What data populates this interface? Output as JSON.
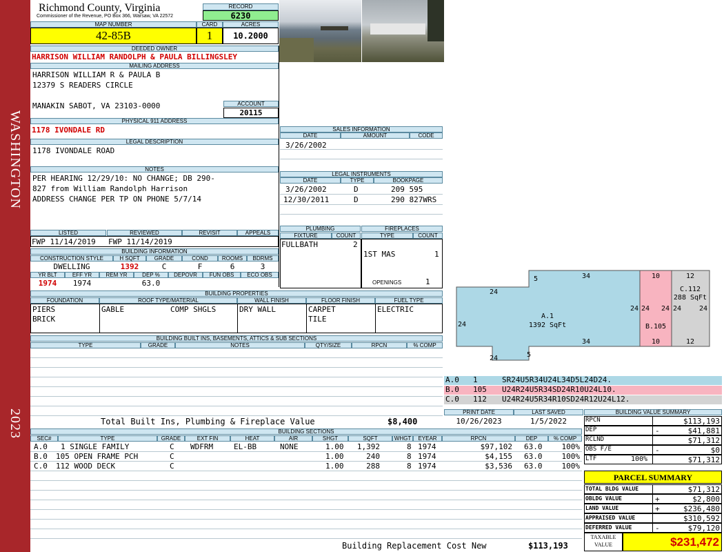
{
  "sidebar": {
    "district": "WASHINGTON",
    "year": "2023"
  },
  "header": {
    "county": "Richmond County, Virginia",
    "commissioner": "Commissioner of the Revenue, PO Box 366, Warsaw, VA 22572",
    "record_label": "RECORD",
    "record_value": "6230",
    "map_label": "MAP NUMBER",
    "map_value": "42-85B",
    "card_label": "CARD",
    "card_value": "1",
    "acres_label": "ACRES",
    "acres_value": "10.2000"
  },
  "owner": {
    "label": "DEEDED OWNER",
    "value": "HARRISON WILLIAM RANDOLPH & PAULA BILLINGSLEY"
  },
  "mailing": {
    "label": "MAILING ADDRESS",
    "line1": "HARRISON WILLIAM R & PAULA B",
    "line2": "12379 S READERS CIRCLE",
    "line3": "MANAKIN SABOT, VA 23103-0000"
  },
  "account": {
    "label": "ACCOUNT",
    "value": "20115"
  },
  "physical": {
    "label": "PHYSICAL 911 ADDRESS",
    "value": "1178 IVONDALE RD"
  },
  "legal": {
    "label": "LEGAL DESCRIPTION",
    "value": "1178 IVONDALE ROAD"
  },
  "notes": {
    "label": "NOTES",
    "line1": "PER HEARING 12/29/10: NO CHANGE; DB 290-",
    "line2": "827 from William Randolph Harrison",
    "line3": "ADDRESS CHANGE PER TP ON PHONE 5/7/14"
  },
  "sales": {
    "label": "SALES INFORMATION",
    "col_date": "DATE",
    "col_amount": "AMOUNT",
    "col_code": "CODE",
    "rows": [
      {
        "date": "3/26/2002",
        "amount": "",
        "code": ""
      }
    ]
  },
  "instruments": {
    "label": "LEGAL INSTRUMENTS",
    "col_date": "DATE",
    "col_type": "TYPE",
    "col_book": "BOOKPAGE",
    "rows": [
      {
        "date": "3/26/2002",
        "type": "D",
        "book": "209 595"
      },
      {
        "date": "12/30/2011",
        "type": "D",
        "book": "290 827WRS"
      }
    ]
  },
  "listed": {
    "listed_label": "LISTED",
    "listed_value": "FWP 11/14/2019",
    "reviewed_label": "REVIEWED",
    "reviewed_value": "FWP 11/14/2019",
    "revisit_label": "REVISIT",
    "revisit_value": "",
    "appeals_label": "APPEALS",
    "appeals_value": ""
  },
  "building_info": {
    "label": "BUILDING INFORMATION",
    "h_style": "CONSTRUCTION STYLE",
    "h_sqft": "H SQFT",
    "h_grade": "GRADE",
    "h_cond": "COND",
    "h_rooms": "ROOMS",
    "h_bdrms": "BDRMS",
    "style": "DWELLING",
    "sqft": "1392",
    "grade": "C",
    "cond": "F",
    "rooms": "6",
    "bdrms": "3",
    "h_yrblt": "YR BLT",
    "h_effyr": "EFF YR",
    "h_remyr": "REM YR",
    "h_dep": "DEP %",
    "h_depovr": "DEPOVR",
    "h_funobs": "FUN OBS",
    "h_ecoobs": "ECO OBS",
    "yrblt": "1974",
    "effyr": "1974",
    "remyr": "",
    "dep": "63.0",
    "depovr": "",
    "funobs": "",
    "ecoobs": ""
  },
  "plumbing": {
    "label": "PLUMBING",
    "col_fixture": "FIXTURE",
    "col_count": "COUNT",
    "fixture": "FULLBATH",
    "count": "2"
  },
  "fireplaces": {
    "label": "FIREPLACES",
    "col_type": "TYPE",
    "col_count": "COUNT",
    "type": "1ST MAS",
    "count": "1",
    "openings_label": "OPENINGS",
    "openings": "1"
  },
  "properties": {
    "label": "BUILDING PROPERTIES",
    "h_foundation": "FOUNDATION",
    "h_roof": "ROOF TYPE/MATERIAL",
    "h_wall": "WALL FINISH",
    "h_floor": "FLOOR FINISH",
    "h_fuel": "FUEL TYPE",
    "foundation1": "PIERS",
    "foundation2": "BRICK",
    "roof_type": "GABLE",
    "roof_mat": "COMP SHGLS",
    "wall": "DRY WALL",
    "floor1": "CARPET",
    "floor2": "TILE",
    "fuel": "ELECTRIC"
  },
  "builtins": {
    "label": "BUILDING BUILT INS, BASEMENTS, ATTICS & SUB SECTIONS",
    "h_type": "TYPE",
    "h_grade": "GRADE",
    "h_notes": "NOTES",
    "h_qty": "QTY/SIZE",
    "h_rpcn": "RPCN",
    "h_comp": "% COMP",
    "total_label": "Total Built Ins, Plumbing & Fireplace Value",
    "total_value": "$8,400"
  },
  "sections": {
    "label": "BUILDING SECTIONS",
    "headers": [
      "SEC#",
      "TYPE",
      "GRADE",
      "EXT FIN",
      "HEAT",
      "AIR",
      "SHGT",
      "SQFT",
      "WHGT",
      "EYEAR",
      "RPCN",
      "DEP",
      "% COMP"
    ],
    "rows": [
      [
        "A.0",
        "1 SINGLE FAMILY",
        "C",
        "WDFRM",
        "EL-BB",
        "NONE",
        "1.00",
        "1,392",
        "8",
        "1974",
        "$97,102",
        "63.0",
        "100%"
      ],
      [
        "B.0",
        "105 OPEN FRAME PCH",
        "C",
        "",
        "",
        "",
        "1.00",
        "240",
        "8",
        "1974",
        "$4,155",
        "63.0",
        "100%"
      ],
      [
        "C.0",
        "112 WOOD DECK",
        "C",
        "",
        "",
        "",
        "1.00",
        "288",
        "8",
        "1974",
        "$3,536",
        "63.0",
        "100%"
      ]
    ],
    "rcn_label": "Building Replacement Cost New",
    "rcn_value": "$113,193"
  },
  "sketch": {
    "a_label": "A.1",
    "a_sqft": "1392 SqFt",
    "b_label": "B.105",
    "c_label": "C.112",
    "c_sqft": "288 SqFt",
    "dims": [
      "24",
      "5",
      "34",
      "10",
      "12",
      "24",
      "24",
      "24",
      "24",
      "24",
      "24",
      "34",
      "10",
      "12",
      "24",
      "5"
    ],
    "colors": {
      "a": "#add8e6",
      "b": "#f8b4c0",
      "c": "#d3d3d3"
    }
  },
  "legend": {
    "rows": [
      {
        "code": "A.0",
        "num": "1",
        "trace": "SR24U5R34U24L34D5L24D24."
      },
      {
        "code": "B.0",
        "num": "105",
        "trace": "U24R24U5R34SD24R10U24L10."
      },
      {
        "code": "C.0",
        "num": "112",
        "trace": "U24R24U5R34R10SD24R12U24L12."
      }
    ]
  },
  "dates": {
    "print_label": "PRINT DATE",
    "print_value": "10/26/2023",
    "saved_label": "LAST SAVED",
    "saved_value": "1/5/2022"
  },
  "value_summary": {
    "label": "BUILDING VALUE SUMMARY",
    "rows": [
      {
        "label": "RPCN",
        "pct": "",
        "sign": "",
        "value": "$113,193"
      },
      {
        "label": "DEP",
        "pct": "",
        "sign": "-",
        "value": "$41,881"
      },
      {
        "label": "RCLND",
        "pct": "",
        "sign": "",
        "value": "$71,312"
      },
      {
        "label": "OBS F/E",
        "pct": "",
        "sign": "-",
        "value": "$0"
      },
      {
        "label": "LTF",
        "pct": "100%",
        "sign": "",
        "value": "$71,312"
      }
    ]
  },
  "parcel": {
    "label": "PARCEL SUMMARY",
    "rows": [
      {
        "label": "TOTAL BLDG VALUE",
        "sign": "",
        "value": "$71,312"
      },
      {
        "label": "OBLDG VALUE",
        "sign": "+",
        "value": "$2,800"
      },
      {
        "label": "LAND VALUE",
        "sign": "+",
        "value": "$236,480"
      },
      {
        "label": "APPRAISED VALUE",
        "sign": "",
        "value": "$310,592"
      },
      {
        "label": "DEFERRED VALUE",
        "sign": "-",
        "value": "$79,120"
      }
    ],
    "taxable_label1": "TAXABLE",
    "taxable_label2": "VALUE",
    "taxable_value": "$231,472"
  }
}
